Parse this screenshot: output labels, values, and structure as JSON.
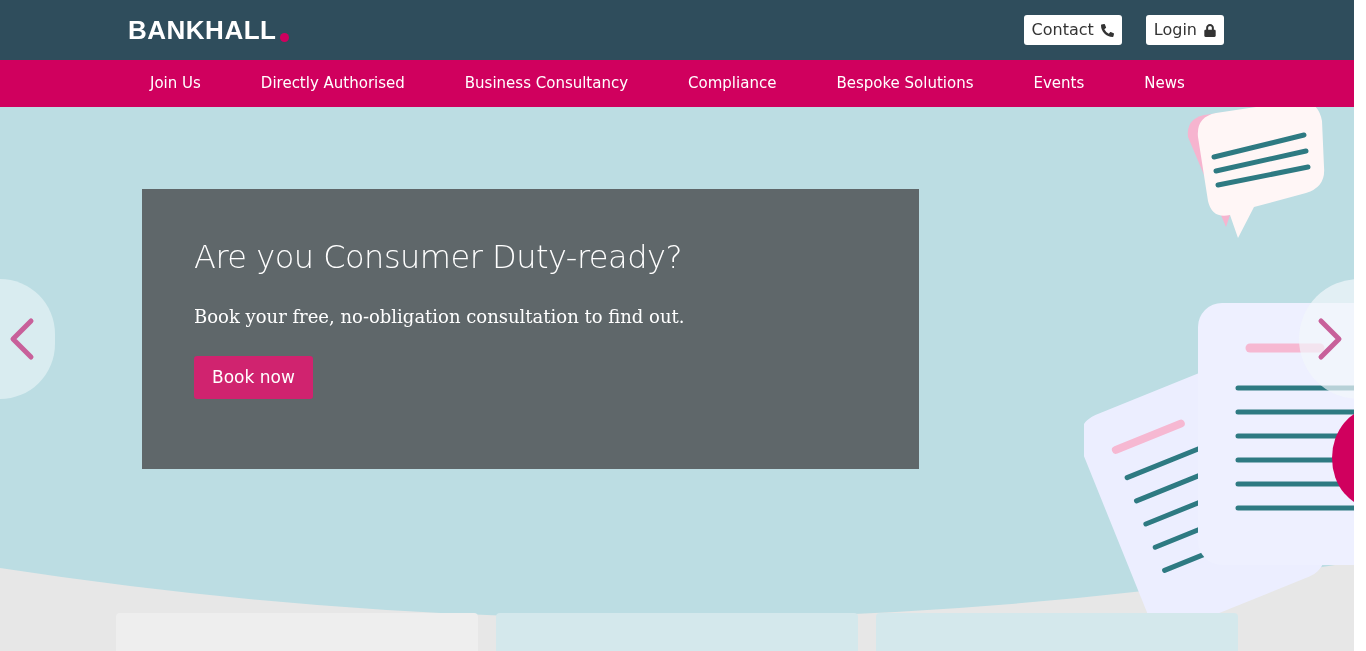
{
  "logo": {
    "text": "BANKHALL"
  },
  "header_links": [
    {
      "label": "Contact",
      "kind": "phone"
    },
    {
      "label": "Login",
      "kind": "lock"
    }
  ],
  "nav": [
    {
      "label": "Join Us"
    },
    {
      "label": "Directly Authorised"
    },
    {
      "label": "Business Consultancy"
    },
    {
      "label": "Compliance"
    },
    {
      "label": "Bespoke Solutions"
    },
    {
      "label": "Events"
    },
    {
      "label": "News"
    }
  ],
  "hero": {
    "title": "Are you Consumer Duty-ready?",
    "text": "Book your free, no-obligation consultation to find out.",
    "button": "Book now"
  }
}
